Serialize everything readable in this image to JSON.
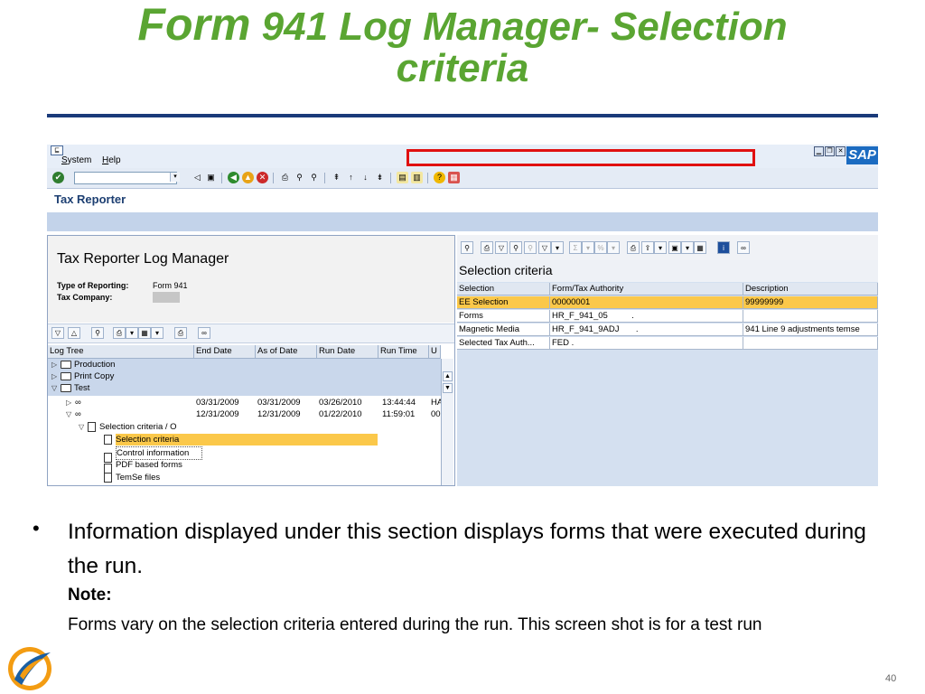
{
  "slide": {
    "title_line1_a": "Form",
    "title_line1_b": "941 Log Manager- Selection",
    "title_line2": "criteria",
    "page_number": "40"
  },
  "window": {
    "menus": [
      "System",
      "Help"
    ],
    "logo": "SAP",
    "app_title": "Tax Reporter"
  },
  "left_panel": {
    "title": "Tax Reporter Log Manager",
    "type_label": "Type of Reporting:",
    "type_value": "Form 941",
    "company_label": "Tax Company:",
    "columns": [
      "Log Tree",
      "End Date",
      "As of Date",
      "Run Date",
      "Run Time",
      "U"
    ],
    "tree": [
      {
        "label": "Production"
      },
      {
        "label": "Print Copy"
      },
      {
        "label": "Test"
      }
    ],
    "runs": [
      {
        "end_date": "03/31/2009",
        "as_of": "03/31/2009",
        "run_date": "03/26/2010",
        "run_time": "13:44:44",
        "u": "HA"
      },
      {
        "end_date": "12/31/2009",
        "as_of": "12/31/2009",
        "run_date": "01/22/2010",
        "run_time": "11:59:01",
        "u": "00"
      }
    ],
    "sub_node": "Selection criteria / O",
    "children": [
      "Selection criteria",
      "Control information",
      "PDF based forms",
      "TemSe files"
    ]
  },
  "right_panel": {
    "title": "Selection criteria",
    "columns": [
      "Selection",
      "Form/Tax Authority",
      "Description"
    ],
    "rows": [
      {
        "selection": "EE Selection",
        "authority": "00000001",
        "description": "99999999"
      },
      {
        "selection": "Forms",
        "authority": "HR_F_941_05          .",
        "description": ""
      },
      {
        "selection": "Magnetic Media",
        "authority": "HR_F_941_9ADJ       .",
        "description": "941 Line 9 adjustments temse"
      },
      {
        "selection": "Selected Tax Auth...",
        "authority": "FED .",
        "description": ""
      }
    ]
  },
  "body": {
    "bullet": "Information displayed under this section displays forms that were executed during the run.",
    "note_label": "Note:",
    "note_text": "Forms vary on the selection criteria entered during the run.  This screen shot is for a test  run"
  },
  "colors": {
    "title_green": "#5aa532",
    "rule_blue": "#1a3a7a",
    "highlight": "#fbc84a",
    "callout_red": "#e01010"
  }
}
